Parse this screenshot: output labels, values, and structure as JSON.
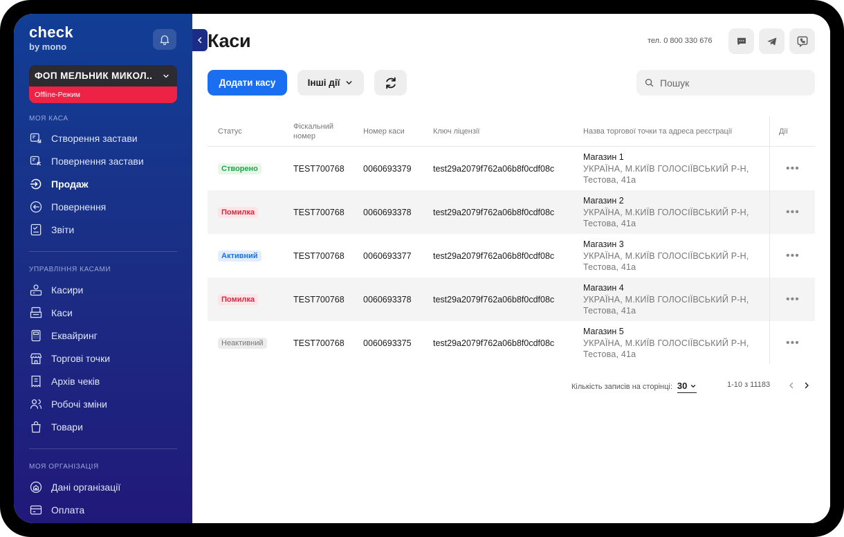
{
  "brand": {
    "name": "check",
    "sub": "by mono"
  },
  "org": {
    "name": "ФОП МЕЛЬНИК МИКОЛ..",
    "mode": "Offline-Режим"
  },
  "sidebar": {
    "sections": [
      {
        "title": "МОЯ КАСА",
        "items": [
          {
            "label": "Створення застави",
            "icon": "deposit-create-icon"
          },
          {
            "label": "Повернення застави",
            "icon": "deposit-return-icon"
          },
          {
            "label": "Продаж",
            "icon": "sale-icon",
            "active": true
          },
          {
            "label": "Повернення",
            "icon": "return-icon"
          },
          {
            "label": "Звіти",
            "icon": "reports-icon"
          }
        ]
      },
      {
        "title": "УПРАВЛІННЯ КАСАМИ",
        "items": [
          {
            "label": "Касири",
            "icon": "cashiers-icon"
          },
          {
            "label": "Каси",
            "icon": "registers-icon"
          },
          {
            "label": "Еквайринг",
            "icon": "acquiring-icon"
          },
          {
            "label": "Торгові точки",
            "icon": "store-icon"
          },
          {
            "label": "Архів чеків",
            "icon": "receipts-archive-icon"
          },
          {
            "label": "Робочі зміни",
            "icon": "shifts-icon"
          },
          {
            "label": "Товари",
            "icon": "products-icon"
          }
        ]
      },
      {
        "title": "МОЯ ОРГАНІЗАЦІЯ",
        "items": [
          {
            "label": "Дані організації",
            "icon": "organization-icon"
          },
          {
            "label": "Оплата",
            "icon": "payment-card-icon"
          }
        ]
      }
    ]
  },
  "header": {
    "title": "Каси",
    "phone": "тел. 0 800 330 676",
    "contact_icons": [
      "chat-icon",
      "telegram-icon",
      "viber-icon"
    ]
  },
  "toolbar": {
    "add_label": "Додати касу",
    "other_label": "Інші дії",
    "refresh_icon": "refresh-icon",
    "search_placeholder": "Пошук"
  },
  "table": {
    "columns": [
      "Статус",
      "Фіскальний номер",
      "Номер каси",
      "Ключ ліцензії",
      "Назва торгової точки та адреса реєстрації",
      "Дії"
    ],
    "rows": [
      {
        "status": "Створено",
        "status_type": "created",
        "fiscal": "TEST700768",
        "number": "0060693379",
        "key": "test29a2079f762a06b8f0cdf08c",
        "shop": "Магазин 1",
        "address": "УКРАЇНА, М.КИЇВ ГОЛОСІЇВСЬКИЙ Р-Н, Тестова, 41а"
      },
      {
        "status": "Помилка",
        "status_type": "error",
        "fiscal": "TEST700768",
        "number": "0060693378",
        "key": "test29a2079f762a06b8f0cdf08c",
        "shop": "Магазин 2",
        "address": "УКРАЇНА, М.КИЇВ ГОЛОСІЇВСЬКИЙ Р-Н, Тестова, 41а"
      },
      {
        "status": "Активний",
        "status_type": "active",
        "fiscal": "TEST700768",
        "number": "0060693377",
        "key": "test29a2079f762a06b8f0cdf08c",
        "shop": "Магазин 3",
        "address": "УКРАЇНА, М.КИЇВ ГОЛОСІЇВСЬКИЙ Р-Н, Тестова, 41а"
      },
      {
        "status": "Помилка",
        "status_type": "error",
        "fiscal": "TEST700768",
        "number": "0060693378",
        "key": "test29a2079f762a06b8f0cdf08c",
        "shop": "Магазин 4",
        "address": "УКРАЇНА, М.КИЇВ ГОЛОСІЇВСЬКИЙ Р-Н, Тестова, 41а"
      },
      {
        "status": "Неактивний",
        "status_type": "inactive",
        "fiscal": "TEST700768",
        "number": "0060693375",
        "key": "test29a2079f762a06b8f0cdf08c",
        "shop": "Магазин 5",
        "address": "УКРАЇНА, М.КИЇВ ГОЛОСІЇВСЬКИЙ Р-Н, Тестова, 41а"
      }
    ],
    "actions_label": "•••"
  },
  "pagination": {
    "per_page_label": "Кількість записів на сторінці:",
    "per_page_value": "30",
    "range": "1-10 з 11183"
  },
  "colors": {
    "primary": "#1a6ff0",
    "sidebar_top": "#123e96",
    "sidebar_bottom": "#21197a",
    "offline": "#ee2245"
  }
}
